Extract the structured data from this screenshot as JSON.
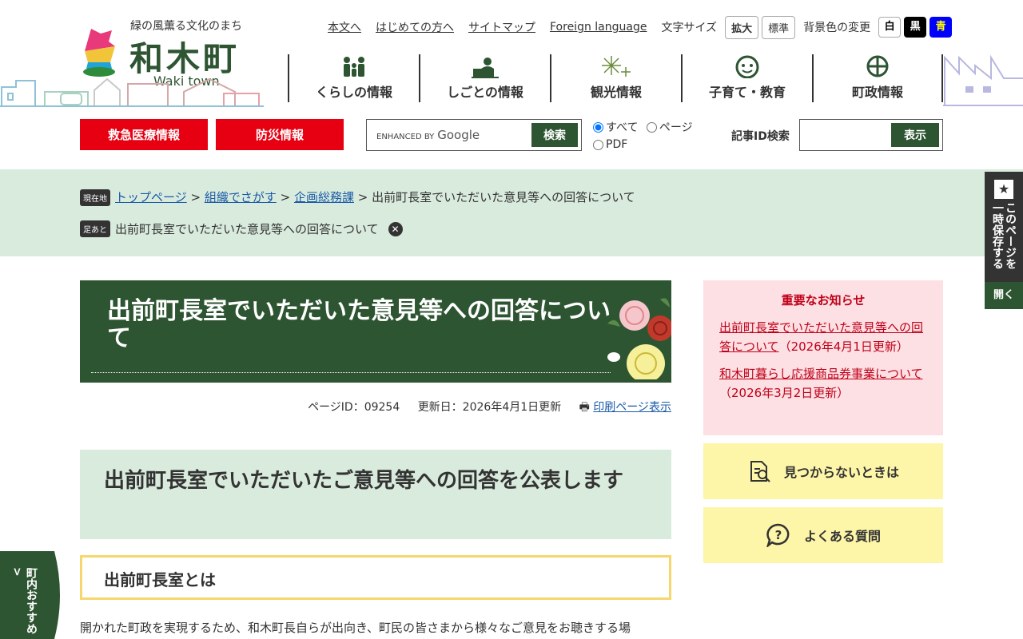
{
  "header": {
    "tagline": "緑の風薫る文化のまち",
    "logo_name": "和木町",
    "logo_roman": "Waki town",
    "utility_links": [
      "本文へ",
      "はじめての方へ",
      "サイトマップ",
      "Foreign language"
    ],
    "font_size_label": "文字サイズ",
    "font_size_buttons": [
      "拡大",
      "標準"
    ],
    "bg_color_label": "背景色の変更",
    "bg_buttons": [
      {
        "label": "白",
        "bg": "#ffffff",
        "fg": "#000000"
      },
      {
        "label": "黒",
        "bg": "#000000",
        "fg": "#ffffff"
      },
      {
        "label": "青",
        "bg": "#0000ff",
        "fg": "#ffff00"
      }
    ]
  },
  "global_nav": [
    {
      "label": "くらしの情報",
      "icon": "family-icon"
    },
    {
      "label": "しごとの情報",
      "icon": "worker-icon"
    },
    {
      "label": "観光情報",
      "icon": "fireworks-icon"
    },
    {
      "label": "子育て・教育",
      "icon": "child-face-icon"
    },
    {
      "label": "町政情報",
      "icon": "town-emblem-icon"
    }
  ],
  "toolbar": {
    "emergency_label": "救急医療情報",
    "disaster_label": "防災情報",
    "search_enhanced": "ENHANCED BY",
    "search_brand": "Google",
    "search_button": "検索",
    "radio_options": [
      "すべて",
      "ページ",
      "PDF"
    ],
    "radio_selected": "すべて",
    "article_id_label": "記事ID検索",
    "article_id_button": "表示"
  },
  "breadcrumb": {
    "current_tag": "現在地",
    "links": [
      "トップページ",
      "組織でさがす",
      "企画総務課"
    ],
    "current": "出前町長室でいただいた意見等への回答について",
    "footprint_tag": "足あと",
    "footprint_item": "出前町長室でいただいた意見等への回答について"
  },
  "side_tab": {
    "label": "このページを一時保存する",
    "open": "開く"
  },
  "main": {
    "title": "出前町長室でいただいた意見等への回答について",
    "page_id": "ページID：09254",
    "updated": "更新日：2026年4月1日更新",
    "print_link": "印刷ページ表示",
    "h2": "出前町長室でいただいたご意見等への回答を公表します",
    "h3": "出前町長室とは",
    "body": "開かれた町政を実現するため、和木町長自らが出向き、町民の皆さまから様々なご意見をお聴きする場"
  },
  "sidebar": {
    "notice_title": "重要なお知らせ",
    "notices": [
      {
        "link": "出前町長室でいただいた意見等への回答について",
        "date": "（2026年4月1日更新）"
      },
      {
        "link": "和木町暮らし応援商品券事業について",
        "date": "（2026年3月2日更新）"
      }
    ],
    "not_found": "見つからないときは",
    "faq": "よくある質問"
  },
  "recommend": {
    "label": "おすすめ",
    "sub": "町内"
  },
  "colors": {
    "brand_green": "#2e5532",
    "emergency_red": "#e60012",
    "light_green_bg": "#d9ebdd",
    "notice_pink": "#fde0e4",
    "yellow_box": "#fdf5a8"
  }
}
